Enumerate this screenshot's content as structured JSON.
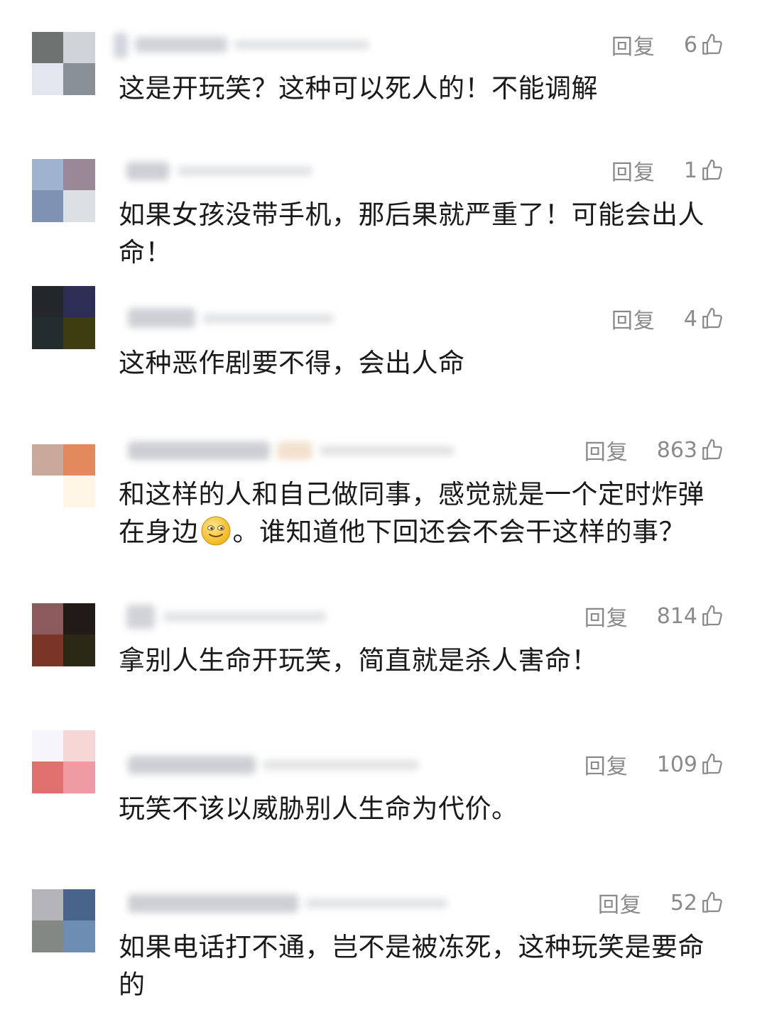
{
  "reply_label": "回复",
  "like_icon": "thumbs-up-outline-icon",
  "text_color": "#1a1a1a",
  "meta_color": "#8a8a8a",
  "comments": [
    {
      "likes": "6",
      "text": "这是开玩笑？这种可以死人的！不能调解",
      "avatar_colors": [
        "#6d7370",
        "#cfd2d6",
        "#e3e6ee",
        "#8a9097"
      ]
    },
    {
      "likes": "1",
      "text": "如果女孩没带手机，那后果就严重了！可能会出人命！",
      "avatar_colors": [
        "#9fb3d1",
        "#9a8898",
        "#7e93b3",
        "#dcdfe3"
      ]
    },
    {
      "likes": "4",
      "text": "这种恶作剧要不得，会出人命",
      "avatar_colors": [
        "#23272b",
        "#2c2e55",
        "#232d2d",
        "#3d3d11"
      ]
    },
    {
      "likes": "863",
      "text_before_emoji": "和这样的人和自己做同事，感觉就是一个定时炸弹在身边",
      "emoji_icon": "smiling-face-emoji-icon",
      "text_after_emoji": "。谁知道他下回还会不会干这样的事？",
      "avatar_colors": [
        "#c9a99a",
        "#e3895d",
        "#ffffff",
        "#fff6e6"
      ]
    },
    {
      "likes": "814",
      "text": "拿别人生命开玩笑，简直就是杀人害命！",
      "avatar_colors": [
        "#8c5a5a",
        "#221a17",
        "#7b3526",
        "#2c2816"
      ]
    },
    {
      "likes": "109",
      "text": "玩笑不该以威胁别人生命为代价。",
      "avatar_colors": [
        "#f5f5fa",
        "#f7d7d5",
        "#e0706e",
        "#ee9ba3"
      ]
    },
    {
      "likes": "52",
      "text": "如果电话打不通，岂不是被冻死，这种玩笑是要命的",
      "avatar_colors": [
        "#b3b3b8",
        "#48648a",
        "#838885",
        "#6d8db2"
      ]
    }
  ]
}
